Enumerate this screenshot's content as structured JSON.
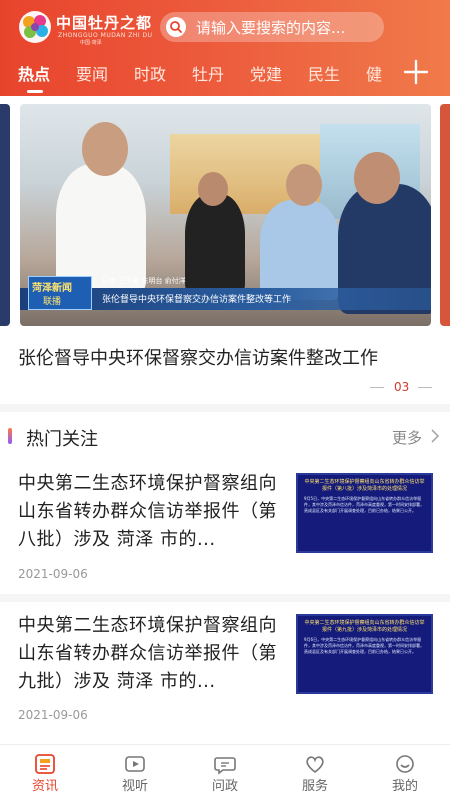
{
  "header": {
    "logo_title": "中国牡丹之都",
    "logo_pinyin": "ZHONGGUO MUDAN ZHI DU",
    "logo_city": "中国·菏泽",
    "search_placeholder": "请输入要搜索的内容...",
    "search_icon": "search-icon",
    "add_icon": "plus-icon"
  },
  "tabs": [
    {
      "label": "热点",
      "active": true
    },
    {
      "label": "要闻",
      "active": false
    },
    {
      "label": "时政",
      "active": false
    },
    {
      "label": "牡丹",
      "active": false
    },
    {
      "label": "党建",
      "active": false
    },
    {
      "label": "民生",
      "active": false
    },
    {
      "label": "健",
      "active": false
    }
  ],
  "banner": {
    "badge_line1": "菏泽新闻",
    "badge_line2": "联播",
    "caption_reporters": "记者  王子夏  东明台  俞付洋",
    "caption_main": "张伦督导中央环保督察交办信访案件整改等工作",
    "headline": "张伦督导中央环保督察交办信访案件整改工作",
    "page_indicator": "03"
  },
  "section": {
    "title": "热门关注",
    "more_label": "更多"
  },
  "news": [
    {
      "title": "中央第二生态环境保护督察组向山东省转办群众信访举报件（第八批）涉及 菏泽 市的...",
      "date": "2021-09-06",
      "thumb_title": "中央第二生态环境保护督察组向山东省转办群众信访举报件（第八批）涉及菏泽市的处理情况",
      "thumb_body": "9月5日，中央第二生态环境保护督察组向山东省转办群众信访举报件，其中涉及菏泽市信访件，菏泽市高度重视，第一时间安排部署，责成县区及有关部门开展调查处理，目前已办结，结果已公开。"
    },
    {
      "title": "中央第二生态环境保护督察组向山东省转办群众信访举报件（第九批）涉及 菏泽 市的...",
      "date": "2021-09-06",
      "thumb_title": "中央第二生态环境保护督察组向山东省转办群众信访举报件（第九批）涉及菏泽市的处理情况",
      "thumb_body": "9月6日，中央第二生态环境保护督察组向山东省转办群众信访举报件，其中涉及菏泽市信访件，菏泽市高度重视，第一时间安排部署，责成县区及有关部门开展调查处理，目前已办结，结果已公开。"
    }
  ],
  "bottom_nav": [
    {
      "label": "资讯",
      "icon": "news-icon",
      "active": true
    },
    {
      "label": "视听",
      "icon": "tv-icon",
      "active": false
    },
    {
      "label": "问政",
      "icon": "chat-bubble-icon",
      "active": false
    },
    {
      "label": "服务",
      "icon": "heart-icon",
      "active": false
    },
    {
      "label": "我的",
      "icon": "smile-icon",
      "active": false
    }
  ],
  "colors": {
    "brand": "#e8442c",
    "header_gradient_end": "#f07a4a",
    "pager_active": "#d23a2a"
  }
}
